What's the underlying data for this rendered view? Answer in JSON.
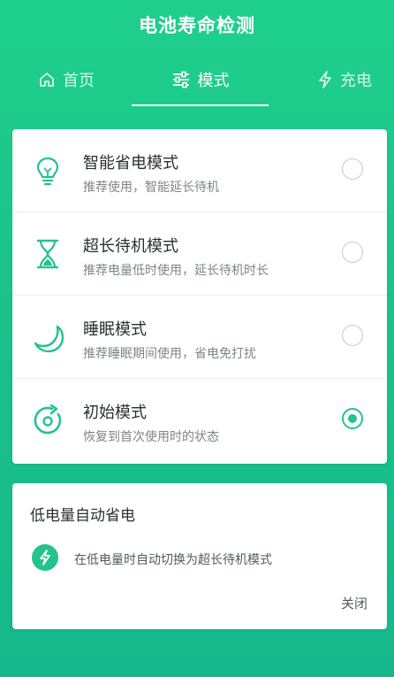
{
  "header": {
    "title": "电池寿命检测"
  },
  "tabs": [
    {
      "label": "首页",
      "icon": "home-icon",
      "active": false
    },
    {
      "label": "模式",
      "icon": "sliders-icon",
      "active": true
    },
    {
      "label": "充电",
      "icon": "lightning-icon",
      "active": false
    }
  ],
  "modes": [
    {
      "title": "智能省电模式",
      "desc": "推荐使用，智能延长待机",
      "icon": "lightbulb-icon",
      "selected": false
    },
    {
      "title": "超长待机模式",
      "desc": "推荐电量低时使用，延长待机时长",
      "icon": "hourglass-icon",
      "selected": false
    },
    {
      "title": "睡眠模式",
      "desc": "推荐睡眠期间使用，省电免打扰",
      "icon": "moon-icon",
      "selected": false
    },
    {
      "title": "初始模式",
      "desc": "恢复到首次使用时的状态",
      "icon": "refresh-icon",
      "selected": true
    }
  ],
  "auto_saver": {
    "title": "低电量自动省电",
    "desc": "在低电量时自动切换为超长待机模式",
    "icon": "lightning-icon",
    "close_label": "关闭"
  },
  "colors": {
    "accent": "#22c38c",
    "background": "#1ac48a",
    "text": "#2a2f33",
    "subtext": "#7d8589"
  }
}
